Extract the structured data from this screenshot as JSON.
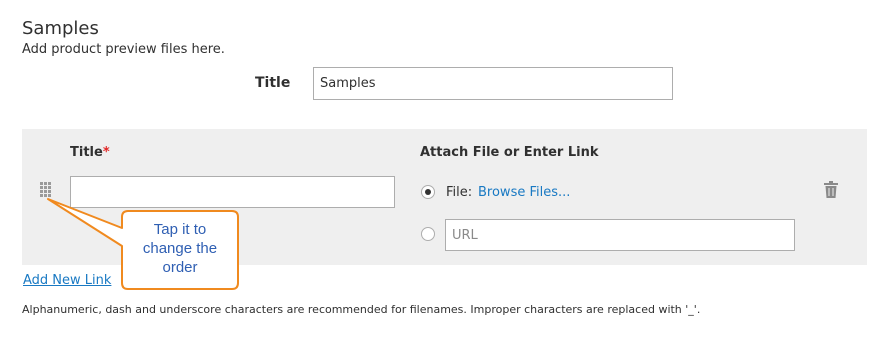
{
  "section": {
    "title": "Samples",
    "description": "Add product preview files here."
  },
  "title_field": {
    "label": "Title",
    "value": "Samples"
  },
  "grid": {
    "col_title_label": "Title",
    "required_mark": "*",
    "col_attach_label": "Attach File or Enter Link",
    "row": {
      "title_value": "",
      "file_option_label": "File:",
      "browse_link": "Browse Files...",
      "file_selected": true,
      "url_placeholder": "URL",
      "delete_icon": "trash-icon",
      "drag_icon": "drag-handle-icon"
    }
  },
  "add_link_label": "Add New Link",
  "note": "Alphanumeric, dash and underscore characters are recommended for filenames. Improper characters are replaced with '_'.",
  "callout": {
    "line1": "Tap it to",
    "line2": "change the",
    "line3": "order"
  },
  "colors": {
    "link": "#1979c3",
    "required": "#e22626",
    "callout_border": "#f08a1f",
    "callout_text": "#2f5fb3",
    "panel_bg": "#efefef"
  }
}
